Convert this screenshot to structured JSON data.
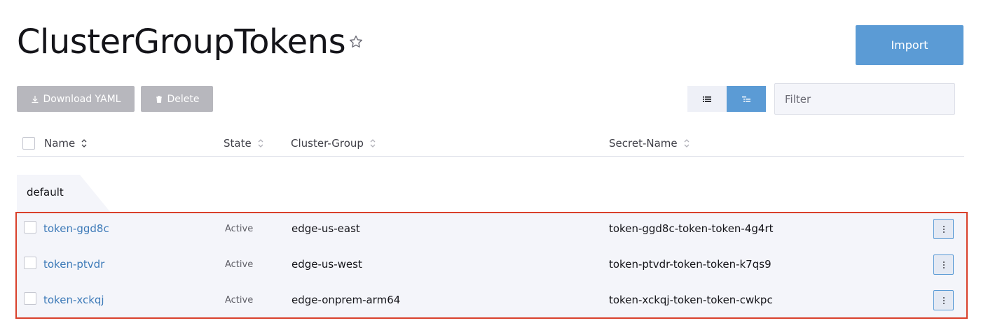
{
  "header": {
    "title": "ClusterGroupTokens",
    "favorite_icon": "star-outline-icon",
    "import_label": "Import"
  },
  "toolbar": {
    "download_label": "Download YAML",
    "download_icon": "download-icon",
    "delete_label": "Delete",
    "delete_icon": "trash-icon",
    "view_modes": [
      "list-icon",
      "grouped-list-icon"
    ],
    "active_view": "grouped-list-icon",
    "filter_placeholder": "Filter"
  },
  "table": {
    "columns": [
      {
        "label": "Name"
      },
      {
        "label": "State"
      },
      {
        "label": "Cluster-Group"
      },
      {
        "label": "Secret-Name"
      }
    ],
    "group": {
      "label": "default"
    },
    "rows": [
      {
        "name": "token-ggd8c",
        "state": "Active",
        "cluster_group": "edge-us-east",
        "secret_name": "token-ggd8c-token-token-4g4rt"
      },
      {
        "name": "token-ptvdr",
        "state": "Active",
        "cluster_group": "edge-us-west",
        "secret_name": "token-ptvdr-token-token-k7qs9"
      },
      {
        "name": "token-xckqj",
        "state": "Active",
        "cluster_group": "edge-onprem-arm64",
        "secret_name": "token-xckqj-token-token-cwkpc"
      }
    ]
  },
  "colors": {
    "accent": "#5b9bd5",
    "link": "#3d7ab8",
    "highlight_border": "#d9402b",
    "row_background": "#f4f5fa",
    "disabled_button": "#b7b7bd"
  }
}
